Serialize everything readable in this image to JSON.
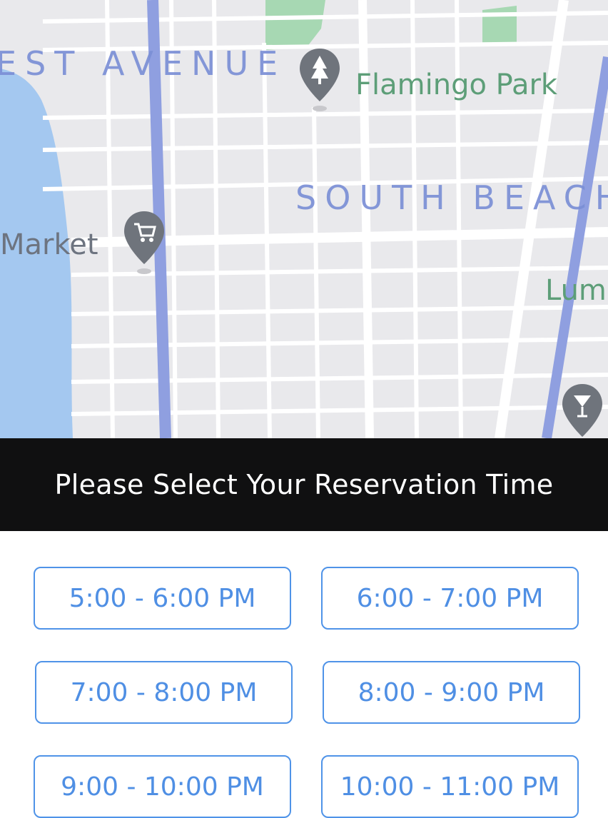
{
  "map": {
    "area_labels": [
      "EST AVENUE",
      "SOUTH BEACH"
    ],
    "places": {
      "park": "Flamingo Park",
      "market": "Market",
      "lummus": "Lum"
    },
    "icons": [
      "park-pin-icon",
      "shopping-cart-pin-icon",
      "cocktail-bar-pin-icon"
    ],
    "colors": {
      "land": "#e9e9ec",
      "water": "#a4c8f0",
      "park": "#a7d8b3",
      "road": "#ffffff",
      "arterial": "#8f9fe0"
    }
  },
  "banner": {
    "title": "Please Select Your Reservation Time"
  },
  "slots": [
    "5:00 - 6:00 PM",
    "6:00 - 7:00 PM",
    "7:00 - 8:00 PM",
    "8:00 - 9:00 PM",
    "9:00 - 10:00 PM",
    "10:00 - 11:00 PM"
  ],
  "colors": {
    "accent": "#4f93e8",
    "banner_bg": "#101011",
    "banner_text": "#ffffff"
  }
}
